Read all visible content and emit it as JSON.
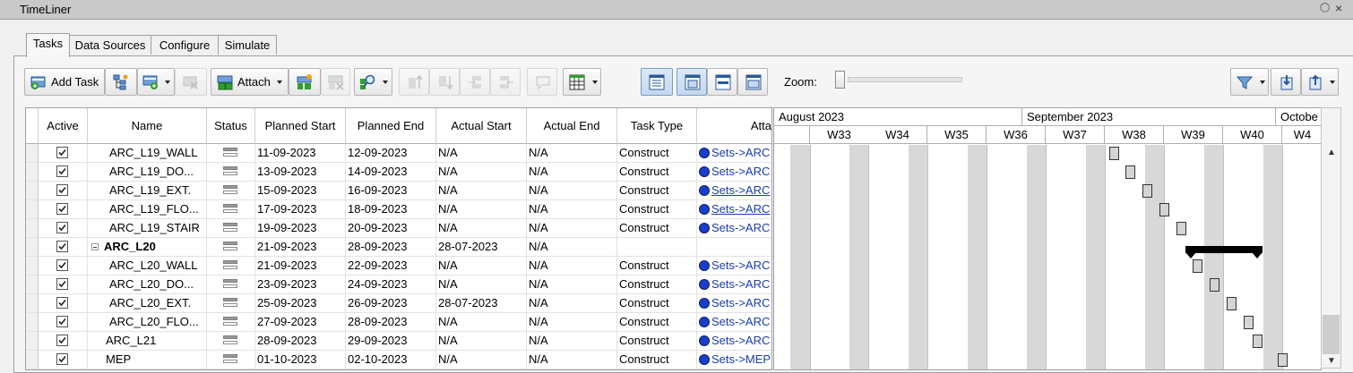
{
  "window": {
    "title": "TimeLiner"
  },
  "tabs": [
    "Tasks",
    "Data Sources",
    "Configure",
    "Simulate"
  ],
  "toolbar": {
    "add_task": "Add Task",
    "attach": "Attach",
    "zoom_label": "Zoom:"
  },
  "grid": {
    "columns": [
      "Active",
      "Name",
      "Status",
      "Planned Start",
      "Planned End",
      "Actual Start",
      "Actual End",
      "Task Type",
      "Atta"
    ],
    "rows": [
      {
        "name": "ARC_L19_WALL",
        "ps": "11-09-2023",
        "pe": "12-09-2023",
        "as": "N/A",
        "ae": "N/A",
        "type": "Construct",
        "att": "Sets->ARC"
      },
      {
        "name": "ARC_L19_DO...",
        "ps": "13-09-2023",
        "pe": "14-09-2023",
        "as": "N/A",
        "ae": "N/A",
        "type": "Construct",
        "att": "Sets->ARC"
      },
      {
        "name": "ARC_L19_EXT.",
        "ps": "15-09-2023",
        "pe": "16-09-2023",
        "as": "N/A",
        "ae": "N/A",
        "type": "Construct",
        "att": "Sets->ARC"
      },
      {
        "name": "ARC_L19_FLO...",
        "ps": "17-09-2023",
        "pe": "18-09-2023",
        "as": "N/A",
        "ae": "N/A",
        "type": "Construct",
        "att": "Sets->ARC"
      },
      {
        "name": "ARC_L19_STAIR",
        "ps": "19-09-2023",
        "pe": "20-09-2023",
        "as": "N/A",
        "ae": "N/A",
        "type": "Construct",
        "att": "Sets->ARC"
      },
      {
        "name": "ARC_L20",
        "ps": "21-09-2023",
        "pe": "28-09-2023",
        "as": "28-07-2023",
        "ae": "N/A",
        "type": "",
        "att": ""
      },
      {
        "name": "ARC_L20_WALL",
        "ps": "21-09-2023",
        "pe": "22-09-2023",
        "as": "N/A",
        "ae": "N/A",
        "type": "Construct",
        "att": "Sets->ARC"
      },
      {
        "name": "ARC_L20_DO...",
        "ps": "23-09-2023",
        "pe": "24-09-2023",
        "as": "N/A",
        "ae": "N/A",
        "type": "Construct",
        "att": "Sets->ARC"
      },
      {
        "name": "ARC_L20_EXT.",
        "ps": "25-09-2023",
        "pe": "26-09-2023",
        "as": "28-07-2023",
        "ae": "N/A",
        "type": "Construct",
        "att": "Sets->ARC"
      },
      {
        "name": "ARC_L20_FLO...",
        "ps": "27-09-2023",
        "pe": "28-09-2023",
        "as": "N/A",
        "ae": "N/A",
        "type": "Construct",
        "att": "Sets->ARC"
      },
      {
        "name": "ARC_L21",
        "ps": "28-09-2023",
        "pe": "29-09-2023",
        "as": "N/A",
        "ae": "N/A",
        "type": "Construct",
        "att": "Sets->ARC"
      },
      {
        "name": "MEP",
        "ps": "01-10-2023",
        "pe": "02-10-2023",
        "as": "N/A",
        "ae": "N/A",
        "type": "Construct",
        "att": "Sets->MEP"
      }
    ]
  },
  "gantt": {
    "months": [
      "August 2023",
      "September 2023",
      "Octobe"
    ],
    "weeks": [
      "W33",
      "W34",
      "W35",
      "W36",
      "W37",
      "W38",
      "W39",
      "W40",
      "W4"
    ]
  }
}
